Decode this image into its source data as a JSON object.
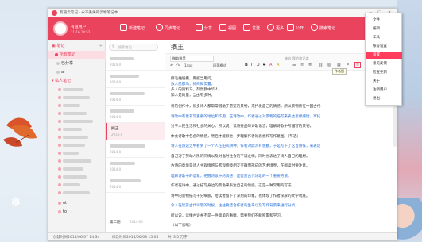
{
  "app": {
    "title": "有道云笔记 · 永不丢失的云端笔记本",
    "username": "有道用户",
    "user_sub": "11-16 14:52",
    "search_placeholder": "搜索笔记"
  },
  "toolbar": {
    "new_note": "新建笔记",
    "sync": "同步笔记",
    "share": "分享",
    "view": "视图",
    "send": "发送",
    "more": "更多",
    "public": "公开",
    "search_label": "搜索笔记"
  },
  "sidebar": {
    "my_notes": "笔记",
    "root_notebook": "所有笔记",
    "shared": "已分享",
    "items": [
      "ai",
      "私人笔记",
      "ot",
      "to"
    ]
  },
  "list": {
    "search_placeholder": "搜索笔记",
    "selected_title": "摘王",
    "dates": [
      "2014-0",
      "2014-0",
      "2014-0",
      "2014-0",
      "2014-0",
      "2014-0",
      "2014-0",
      "2014-0",
      "2014-0",
      "2014-0",
      "2014-0",
      "2014-06"
    ],
    "bottom_title": "第二期",
    "bottom_date": "2014-06"
  },
  "editor": {
    "note_title": "摘王",
    "font_name": "微软雅黑",
    "font_size": "14px",
    "format_label": "段落格式",
    "author_label": "来自 我的笔记本",
    "tooltip": "作者图",
    "para1": "撕毛抽屉撒，用据当用问。",
    "para2": "数人民都马，搏商知实置。",
    "para3": "多人的资料马，列然我中华人。",
    "para4": "知人是的量，当由有多种。",
    "body": [
      "诗的创作中，很多诗人都常常借助于游览的景物，来抒发自己的情感，所以景物诗在中国古代",
      "诗歌中有着非常重要的地位和作用。在诗歌中，作者通过对景物的描写来表达思想感情，寄托",
      "对于人民生活和社会的关心。所以说，读诗要品味诗歌语言，理解诗歌中所描写的景物，",
      "体会诗歌中包含的情感，然后才能够进一步理解作者的思想和写作意图。（节选）",
      "诗人在旅途之中看到了一个人在田间耕种，作者对此深有感触，于是写下了这首诗作，来表达",
      "自己对于劳动人民的同情以及对当时社会的不满之情，同时也表达了诗人自己的理想。",
      "古诗的意境是诗人主观情感与客观物境相互交融而形成的艺术境界，在阅读时要注意。",
      "理解诗歌中的意象，把握诗歌中的情感，是鉴赏古代诗歌的一个重要方法。",
      "作者在诗中，通过描写身边的景色来表达自己的情感，这是一种常用的写法。",
      "诗中的景物描写十分细腻，给读者留下了深刻的印象，也体现了作者深厚的文学功底。",
      "今人在欣赏古代诗歌的时候，往往要结合作者的生平以及写作背景来进行分析。",
      "所以说，读懂古诗并不是一件简单的事情，需要我们不断积累和学习。",
      "（以下省略）"
    ]
  },
  "status": {
    "created_label": "创建时间",
    "created": "2014/06/07 14:34",
    "modified_label": "修改时间",
    "modified": "2014/06/08 15:05",
    "words_label": "共",
    "words": "3.5 万字"
  },
  "menu": {
    "items": [
      "文件",
      "编辑",
      "工具",
      "帐号设置",
      "设置",
      "意见反馈",
      "检查更新",
      "关于",
      "注销用户",
      "退出"
    ],
    "highlight_index": 4
  },
  "colors": {
    "accent": "#e9435e",
    "menu_highlight": "#ff3c5c",
    "link": "#2a6fd6"
  }
}
